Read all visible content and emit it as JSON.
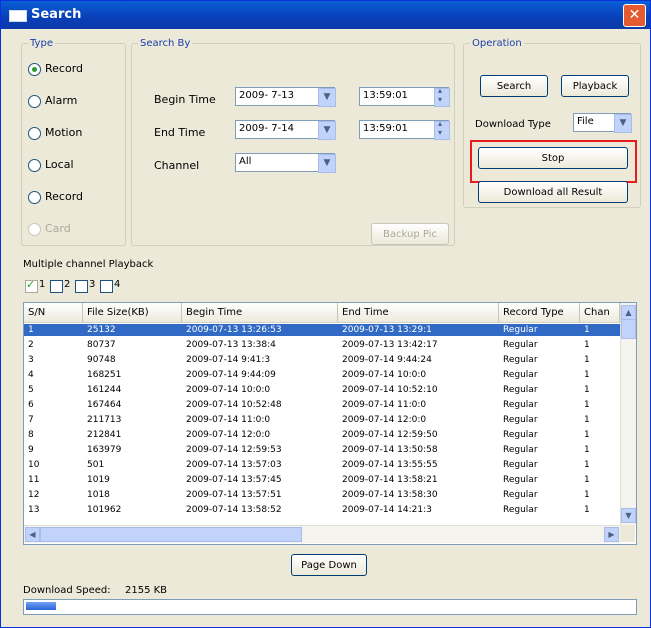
{
  "window": {
    "title": "Search",
    "close_glyph": "✕"
  },
  "type_group": {
    "legend": "Type",
    "options": [
      {
        "label": "Record",
        "selected": true,
        "enabled": true
      },
      {
        "label": "Alarm",
        "selected": false,
        "enabled": true
      },
      {
        "label": "Motion",
        "selected": false,
        "enabled": true
      },
      {
        "label": "Local",
        "selected": false,
        "enabled": true
      },
      {
        "label": "Record",
        "selected": false,
        "enabled": true
      },
      {
        "label": "Card",
        "selected": false,
        "enabled": false
      }
    ]
  },
  "search_by": {
    "legend": "Search By",
    "begin_label": "Begin Time",
    "begin_date": "2009- 7-13",
    "begin_time": "13:59:01",
    "end_label": "End Time",
    "end_date": "2009- 7-14",
    "end_time": "13:59:01",
    "channel_label": "Channel",
    "channel_value": "All",
    "backup_button": "Backup Pic"
  },
  "operation": {
    "legend": "Operation",
    "search_button": "Search",
    "playback_button": "Playback",
    "download_type_label": "Download Type",
    "download_type_value": "File",
    "stop_button": "Stop",
    "download_by_file_button": "Download all Result",
    "highlight_color": "#e81c1c"
  },
  "multi_playback": {
    "label": "Multiple channel Playback",
    "channels": [
      {
        "label": "1",
        "checked": true
      },
      {
        "label": "2",
        "checked": false
      },
      {
        "label": "3",
        "checked": false
      },
      {
        "label": "4",
        "checked": false
      }
    ]
  },
  "table": {
    "columns": [
      "S/N",
      "File Size(KB)",
      "Begin Time",
      "End Time",
      "Record Type",
      "Chan"
    ],
    "rows": [
      [
        "1",
        "25132",
        "2009-07-13 13:26:53",
        "2009-07-13 13:29:1",
        "Regular",
        "1"
      ],
      [
        "2",
        "80737",
        "2009-07-13 13:38:4",
        "2009-07-13 13:42:17",
        "Regular",
        "1"
      ],
      [
        "3",
        "90748",
        "2009-07-14 9:41:3",
        "2009-07-14 9:44:24",
        "Regular",
        "1"
      ],
      [
        "4",
        "168251",
        "2009-07-14 9:44:09",
        "2009-07-14 10:0:0",
        "Regular",
        "1"
      ],
      [
        "5",
        "161244",
        "2009-07-14 10:0:0",
        "2009-07-14 10:52:10",
        "Regular",
        "1"
      ],
      [
        "6",
        "167464",
        "2009-07-14 10:52:48",
        "2009-07-14 11:0:0",
        "Regular",
        "1"
      ],
      [
        "7",
        "211713",
        "2009-07-14 11:0:0",
        "2009-07-14 12:0:0",
        "Regular",
        "1"
      ],
      [
        "8",
        "212841",
        "2009-07-14 12:0:0",
        "2009-07-14 12:59:50",
        "Regular",
        "1"
      ],
      [
        "9",
        "163979",
        "2009-07-14 12:59:53",
        "2009-07-14 13:50:58",
        "Regular",
        "1"
      ],
      [
        "10",
        "501",
        "2009-07-14 13:57:03",
        "2009-07-14 13:55:55",
        "Regular",
        "1"
      ],
      [
        "11",
        "1019",
        "2009-07-14 13:57:45",
        "2009-07-14 13:58:21",
        "Regular",
        "1"
      ],
      [
        "12",
        "1018",
        "2009-07-14 13:57:51",
        "2009-07-14 13:58:30",
        "Regular",
        "1"
      ],
      [
        "13",
        "101962",
        "2009-07-14 13:58:52",
        "2009-07-14 14:21:3",
        "Regular",
        "1"
      ]
    ],
    "selected_row": 0
  },
  "page_down_button": "Page Down",
  "status": {
    "label": "Download Speed:",
    "value": "2155 KB"
  },
  "progress": {
    "fraction": 0.05
  },
  "icons": [
    "window-icon",
    "close-icon",
    "dropdown-arrow-icon",
    "spin-up-icon",
    "spin-down-icon",
    "scroll-up-icon",
    "scroll-down-icon",
    "scroll-left-icon",
    "scroll-right-icon"
  ]
}
